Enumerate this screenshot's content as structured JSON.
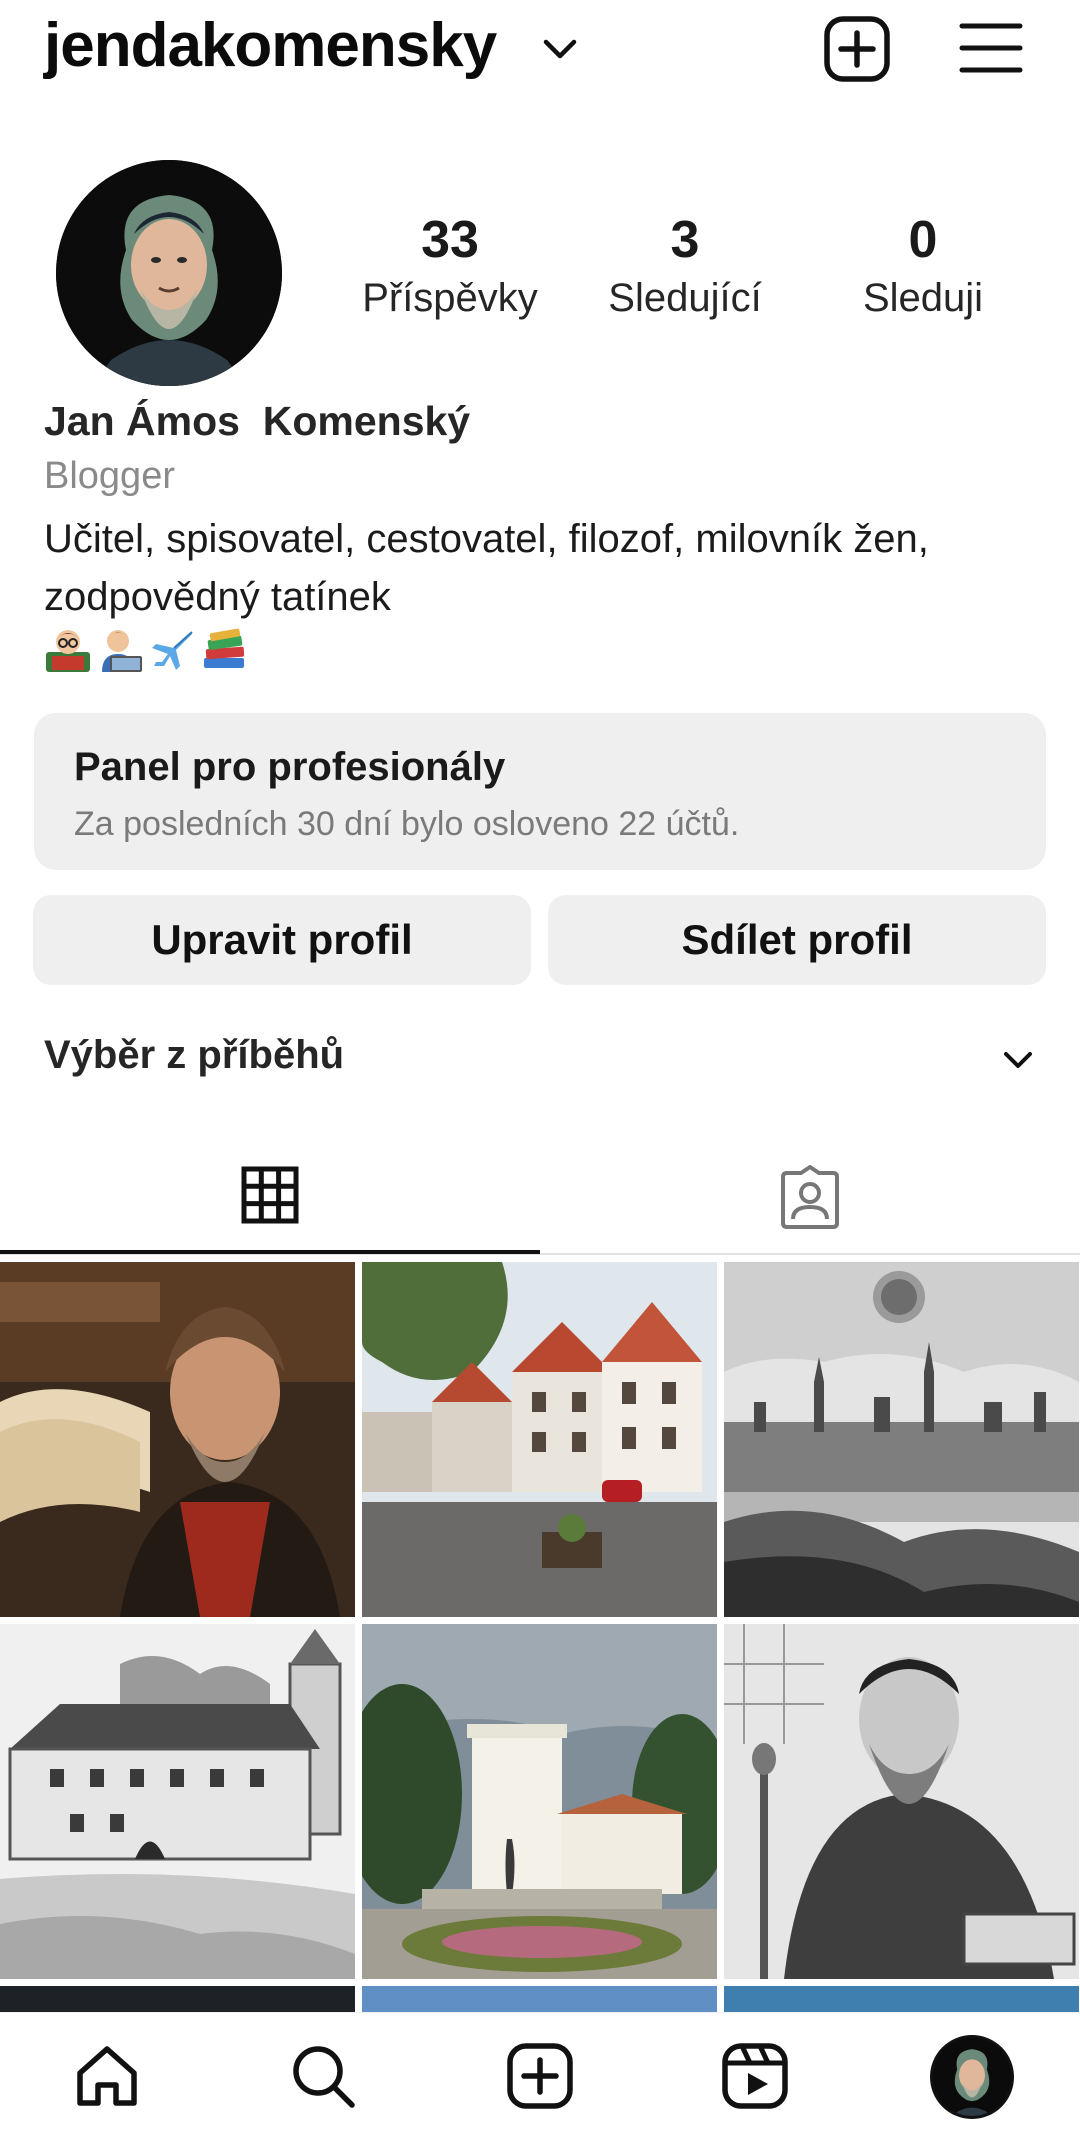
{
  "header": {
    "username": "jendakomensky",
    "username_menu_icon": "chevron-down-icon",
    "create_icon": "plus-square-icon",
    "menu_icon": "hamburger-menu-icon"
  },
  "profile": {
    "avatar_icon": "profile-picture",
    "stats": [
      {
        "count": "33",
        "label": "Příspěvky"
      },
      {
        "count": "3",
        "label": "Sledující"
      },
      {
        "count": "0",
        "label": "Sleduji"
      }
    ],
    "full_name": "Jan Ámos  Komenský",
    "category": "Blogger",
    "bio": "Učitel, spisovatel, cestovatel, filozof, milovník žen,\nzodpovědný  tatínek",
    "bio_emojis": [
      "teacher-emoji",
      "technologist-emoji",
      "airplane-emoji",
      "books-emoji"
    ]
  },
  "professional_dashboard": {
    "title": "Panel pro profesionály",
    "subtitle": "Za posledních 30 dní bylo osloveno 22 účtů."
  },
  "actions": {
    "edit_label": "Upravit profil",
    "share_label": "Sdílet profil"
  },
  "highlights": {
    "title": "Výběr z příběhů",
    "toggle_icon": "chevron-down-icon"
  },
  "tabs": [
    {
      "icon": "grid-icon",
      "active": true
    },
    {
      "icon": "tagged-person-icon",
      "active": false
    }
  ],
  "posts": [
    {
      "subject": "portrait-with-books"
    },
    {
      "subject": "town-street"
    },
    {
      "subject": "stockholm-engraving"
    },
    {
      "subject": "manor-drawing"
    },
    {
      "subject": "white-tower-statue"
    },
    {
      "subject": "portrait-engraving"
    }
  ],
  "bottom_nav": [
    {
      "icon": "home-icon"
    },
    {
      "icon": "search-icon"
    },
    {
      "icon": "plus-square-icon"
    },
    {
      "icon": "reels-icon"
    },
    {
      "icon": "profile-avatar"
    }
  ],
  "colors": {
    "text": "#111111",
    "muted": "#8a8a8a",
    "panel": "#efefef",
    "accent_background": "#ffffff"
  }
}
